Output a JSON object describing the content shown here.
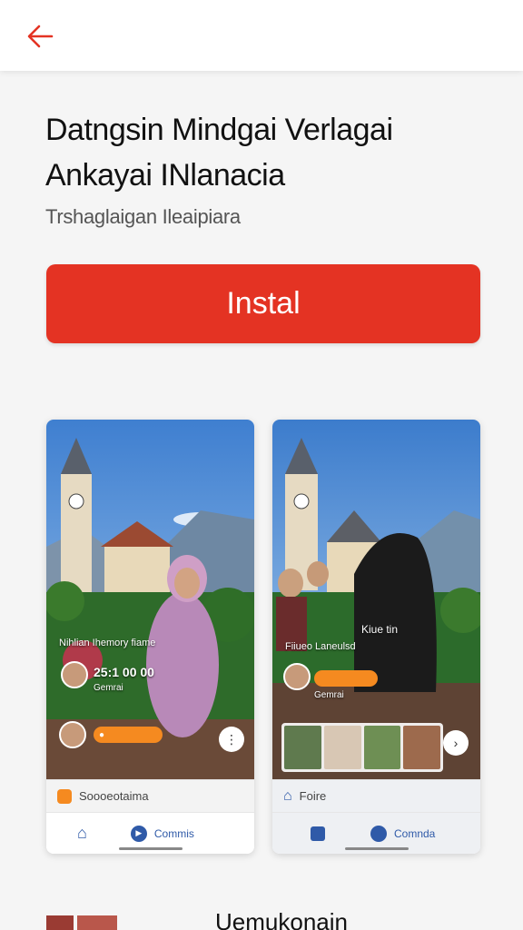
{
  "header": {
    "back_icon": "arrow-left-icon",
    "accent": "#e43323"
  },
  "title": "Datngsin Mindgai Verlagai Ankayai INlanacia",
  "subtitle": "Trshaglaigan Ileaipiara",
  "install_label": "Instal",
  "screenshots": [
    {
      "overlay_title": "Nihlian Ihemory fiame",
      "stat_text": "25:1 00 00",
      "user_text": "Gemrai",
      "pill_icon": "camera-icon",
      "share_icon": "more-icon",
      "bar1_label": "Soooeotaima",
      "bar2_label": "Commis"
    },
    {
      "overlay_title": "Fiiueo Laneulsd",
      "overlay_side": "Kiue tin",
      "user_text": "Gemrai",
      "share_icon": "chevron-right-icon",
      "bar1_label": "Foire",
      "bar2_label": "Comnda"
    }
  ],
  "bottom_text": "Uemukonain"
}
